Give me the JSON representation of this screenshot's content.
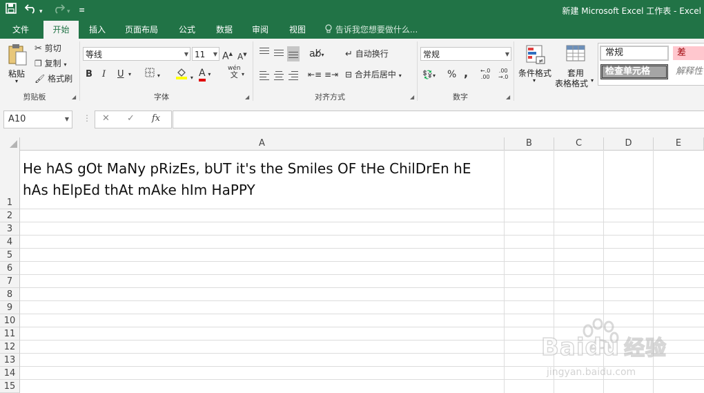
{
  "window": {
    "title": "新建 Microsoft Excel 工作表 - Excel"
  },
  "quick_access": {
    "save_icon": "save-icon",
    "undo_icon": "undo-icon",
    "redo_icon": "redo-icon",
    "customize_icon": "customize-icon"
  },
  "tabs": [
    {
      "label": "文件"
    },
    {
      "label": "开始"
    },
    {
      "label": "插入"
    },
    {
      "label": "页面布局"
    },
    {
      "label": "公式"
    },
    {
      "label": "数据"
    },
    {
      "label": "审阅"
    },
    {
      "label": "视图"
    }
  ],
  "active_tab": "开始",
  "tell_me": "告诉我您想要做什么...",
  "ribbon": {
    "clipboard": {
      "paste": "粘贴",
      "cut": "剪切",
      "copy": "复制",
      "format_painter": "格式刷",
      "label": "剪贴板"
    },
    "font": {
      "font_name": "等线",
      "font_size": "11",
      "bold": "B",
      "italic": "I",
      "underline": "U",
      "font_color": "A",
      "pinyin": "wén",
      "label": "字体"
    },
    "alignment": {
      "wrap": "自动换行",
      "merge": "合并后居中",
      "label": "对齐方式"
    },
    "number": {
      "format": "常规",
      "percent": "%",
      "comma": ",",
      "inc_decimal": "←.0\n.00",
      "dec_decimal": ".00\n→.0",
      "label": "数字"
    },
    "styles": {
      "conditional": "条件格式",
      "table_format_1": "套用",
      "table_format_2": "表格格式",
      "normal": "常规",
      "bad": "差",
      "check_cell": "检查单元格",
      "explanatory": "解释性"
    }
  },
  "formula_bar": {
    "name_box": "A10",
    "cancel": "✕",
    "enter": "✓",
    "fx": "fx",
    "value": ""
  },
  "sheet": {
    "columns": [
      "A",
      "B",
      "C",
      "D",
      "E"
    ],
    "rows": [
      "1",
      "2",
      "3",
      "4",
      "5",
      "6",
      "7",
      "8",
      "9",
      "10",
      "11",
      "12",
      "13",
      "14",
      "15"
    ],
    "cells": {
      "A1_line1": "He hAS gOt MaNy pRizEs, bUT it's the Smiles OF tHe ChilDrEn hE",
      "A1_line2": "hAs hElpEd thAt mAke hIm HaPPY"
    }
  },
  "watermark": {
    "brand": "Baidu",
    "brand_cn": "经验",
    "url": "jingyan.baidu.com"
  }
}
